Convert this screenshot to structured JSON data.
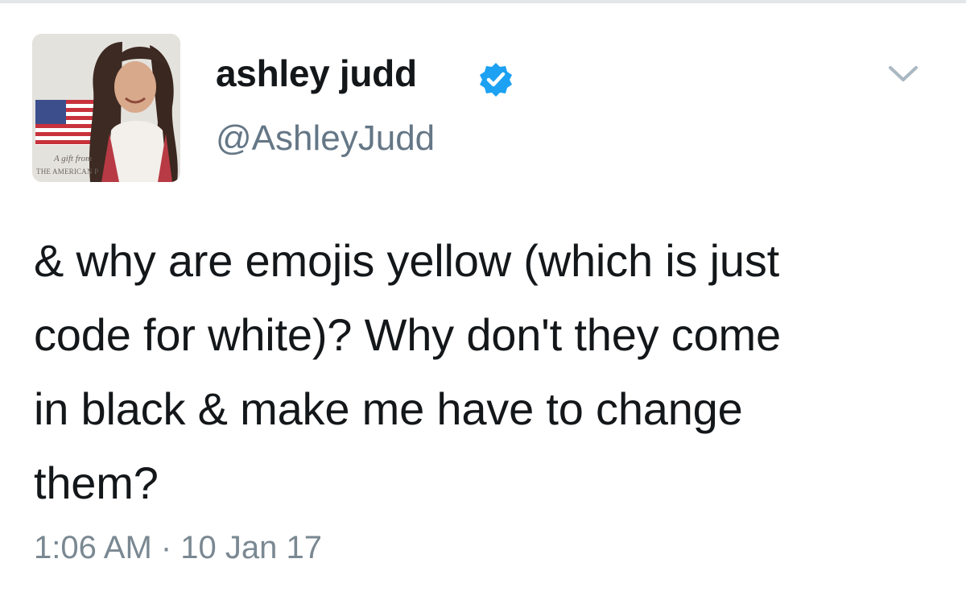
{
  "tweet": {
    "author": {
      "display_name": "ashley judd",
      "handle": "@AshleyJudd",
      "verified": true,
      "avatar": {
        "caption_line1": "A gift from",
        "caption_line2": "THE AMERICAN P"
      }
    },
    "text": "& why are emojis yellow (which is just\ncode for white)?  Why don't they come\nin black & make me have to change\nthem?",
    "timestamp": "1:06 AM · 10 Jan 17"
  },
  "icons": {
    "verified": "verified-badge-icon",
    "menu": "chevron-down-icon"
  },
  "colors": {
    "verified_blue": "#1da1f2",
    "text": "#14171a",
    "secondary": "#657786"
  }
}
